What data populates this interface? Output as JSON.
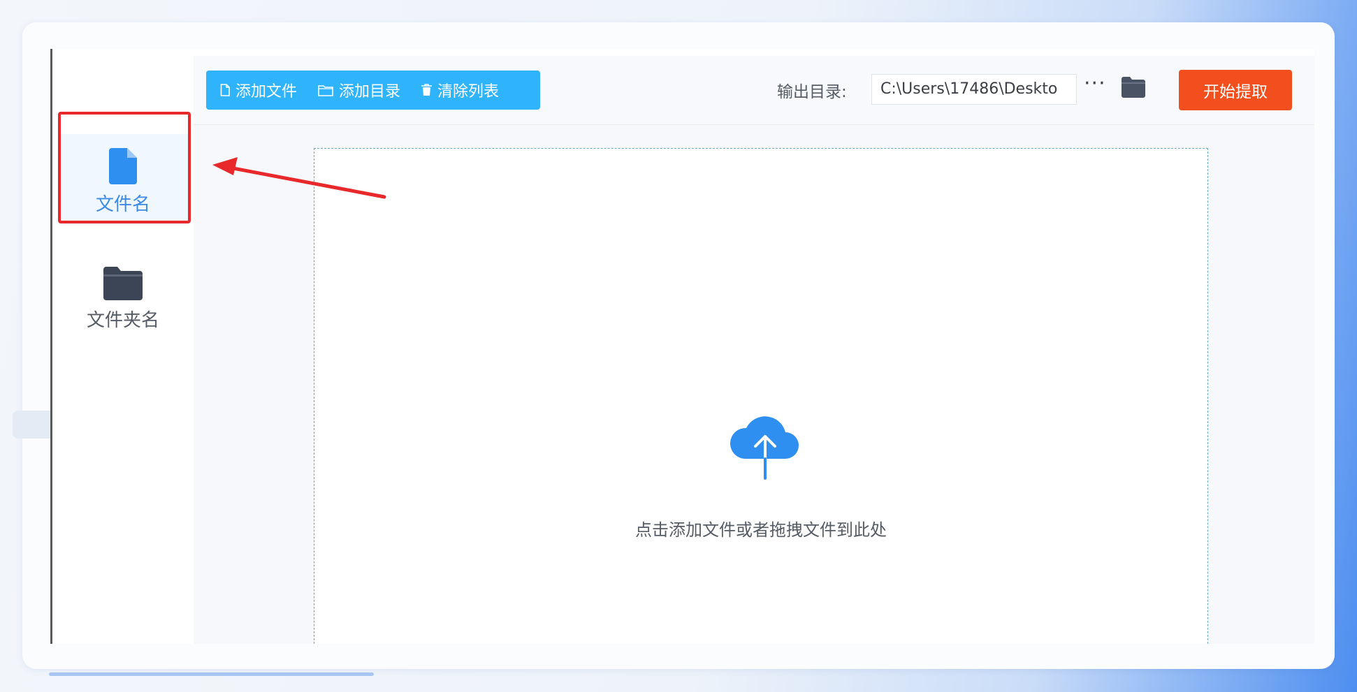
{
  "sidebar": {
    "items": [
      {
        "label": "文件名",
        "icon": "file-icon",
        "active": true
      },
      {
        "label": "文件夹名",
        "icon": "folder-icon",
        "active": false
      }
    ]
  },
  "toolbar": {
    "add_file": "添加文件",
    "add_dir": "添加目录",
    "clear_list": "清除列表",
    "output_label": "输出目录:",
    "output_path": "C:\\Users\\17486\\Deskto",
    "more": "···",
    "start": "开始提取"
  },
  "dropzone": {
    "hint": "点击添加文件或者拖拽文件到此处",
    "icon": "cloud-upload-icon"
  },
  "colors": {
    "accent": "#2fb4fb",
    "start_button": "#f24e1e",
    "active_item": "#3b8be5",
    "annotation": "#e8282a"
  }
}
